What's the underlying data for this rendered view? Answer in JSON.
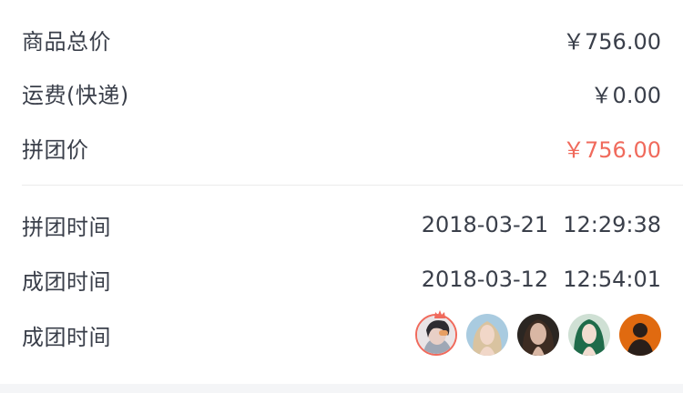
{
  "summary": {
    "rows": [
      {
        "label": "商品总价",
        "value": "￥756.00"
      },
      {
        "label": "运费(快递)",
        "value": "￥0.00"
      },
      {
        "label": "拼团价",
        "value": "￥756.00"
      }
    ],
    "highlight_color": "#f06a5c"
  },
  "times": {
    "rows": [
      {
        "label": "拼团时间",
        "date": "2018-03-21",
        "time": "12:29:38"
      },
      {
        "label": "成团时间",
        "date": "2018-03-12",
        "time": "12:54:01"
      }
    ]
  },
  "members": {
    "label": "成团时间",
    "avatars": [
      {
        "name": "member-avatar-1",
        "leader": true
      },
      {
        "name": "member-avatar-2",
        "leader": false
      },
      {
        "name": "member-avatar-3",
        "leader": false
      },
      {
        "name": "member-avatar-4",
        "leader": false
      },
      {
        "name": "member-avatar-5",
        "leader": false
      }
    ]
  }
}
